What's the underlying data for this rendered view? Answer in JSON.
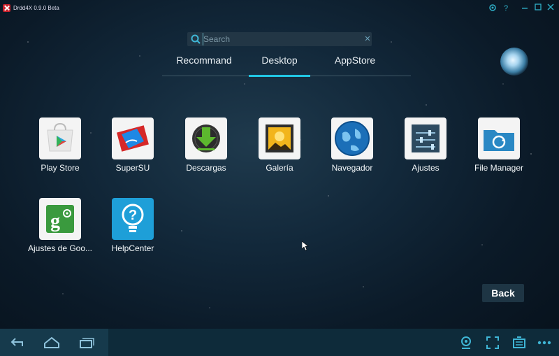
{
  "window": {
    "title": "Drdd4X 0.9.0 Beta",
    "controls": [
      "settings-icon",
      "help-icon",
      "minimize-icon",
      "maximize-icon",
      "close-icon"
    ],
    "help_label": "?"
  },
  "search": {
    "placeholder": "Search",
    "value": ""
  },
  "tabs": [
    {
      "label": "Recommand",
      "active": false
    },
    {
      "label": "Desktop",
      "active": true
    },
    {
      "label": "AppStore",
      "active": false
    }
  ],
  "apps": [
    {
      "label": "Play Store",
      "icon": "play-store-icon"
    },
    {
      "label": "SuperSU",
      "icon": "supersu-icon"
    },
    {
      "label": "Descargas",
      "icon": "download-icon"
    },
    {
      "label": "Galería",
      "icon": "gallery-icon"
    },
    {
      "label": "Navegador",
      "icon": "browser-icon"
    },
    {
      "label": "Ajustes",
      "icon": "settings-sliders-icon"
    },
    {
      "label": "File Manager",
      "icon": "file-manager-icon"
    },
    {
      "label": "Ajustes de Goo...",
      "icon": "google-settings-icon"
    },
    {
      "label": "HelpCenter",
      "icon": "helpcenter-icon"
    }
  ],
  "back_button": "Back",
  "navbar": {
    "left": [
      "back-arrow-icon",
      "home-icon",
      "recent-apps-icon"
    ],
    "right": [
      "camera-icon",
      "fullscreen-icon",
      "keyboard-icon",
      "more-icon"
    ]
  },
  "colors": {
    "accent": "#21c7e4",
    "navbar": "#0e2b3a",
    "title_icons": "#2fb0c8"
  }
}
